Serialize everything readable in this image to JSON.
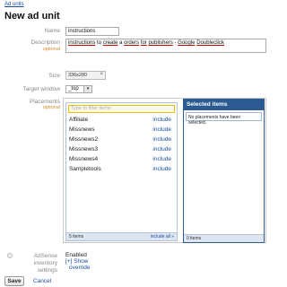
{
  "breadcrumb": "Ad units",
  "page_title": "New ad unit",
  "fields": {
    "name_label": "Name",
    "name_value": "instructions",
    "description_label": "Description",
    "description_optional": "optional",
    "description_parts": [
      "instructions",
      "to",
      "create",
      "a",
      "orders",
      "for",
      "publishers",
      "-",
      "Google",
      "Doubleclick"
    ],
    "size_label": "Size",
    "size_chip": "336x280",
    "size_remove": "×",
    "target_label": "Target window",
    "target_value": "_top",
    "target_dropdown": "▾",
    "placements_label": "Placements",
    "placements_optional": "optional"
  },
  "placements": {
    "filter_placeholder": "Type to filter items",
    "items": [
      {
        "name": "Affiliate",
        "action": "include"
      },
      {
        "name": "Missnews",
        "action": "include"
      },
      {
        "name": "Missnews2",
        "action": "include"
      },
      {
        "name": "Missnews3",
        "action": "include"
      },
      {
        "name": "Missnews4",
        "action": "include"
      },
      {
        "name": "Sampletools",
        "action": "include"
      }
    ],
    "footer_count": "5 items",
    "include_all": "include all »",
    "selected_title": "Selected items",
    "selected_empty": "No placements have been selected.",
    "selected_footer": "0 items"
  },
  "adsense": {
    "label": "AdSense inventory settings",
    "status": "Enabled",
    "show_link": "[+] Show",
    "override_link": "override"
  },
  "actions": {
    "save": "Save",
    "cancel": "Cancel"
  }
}
